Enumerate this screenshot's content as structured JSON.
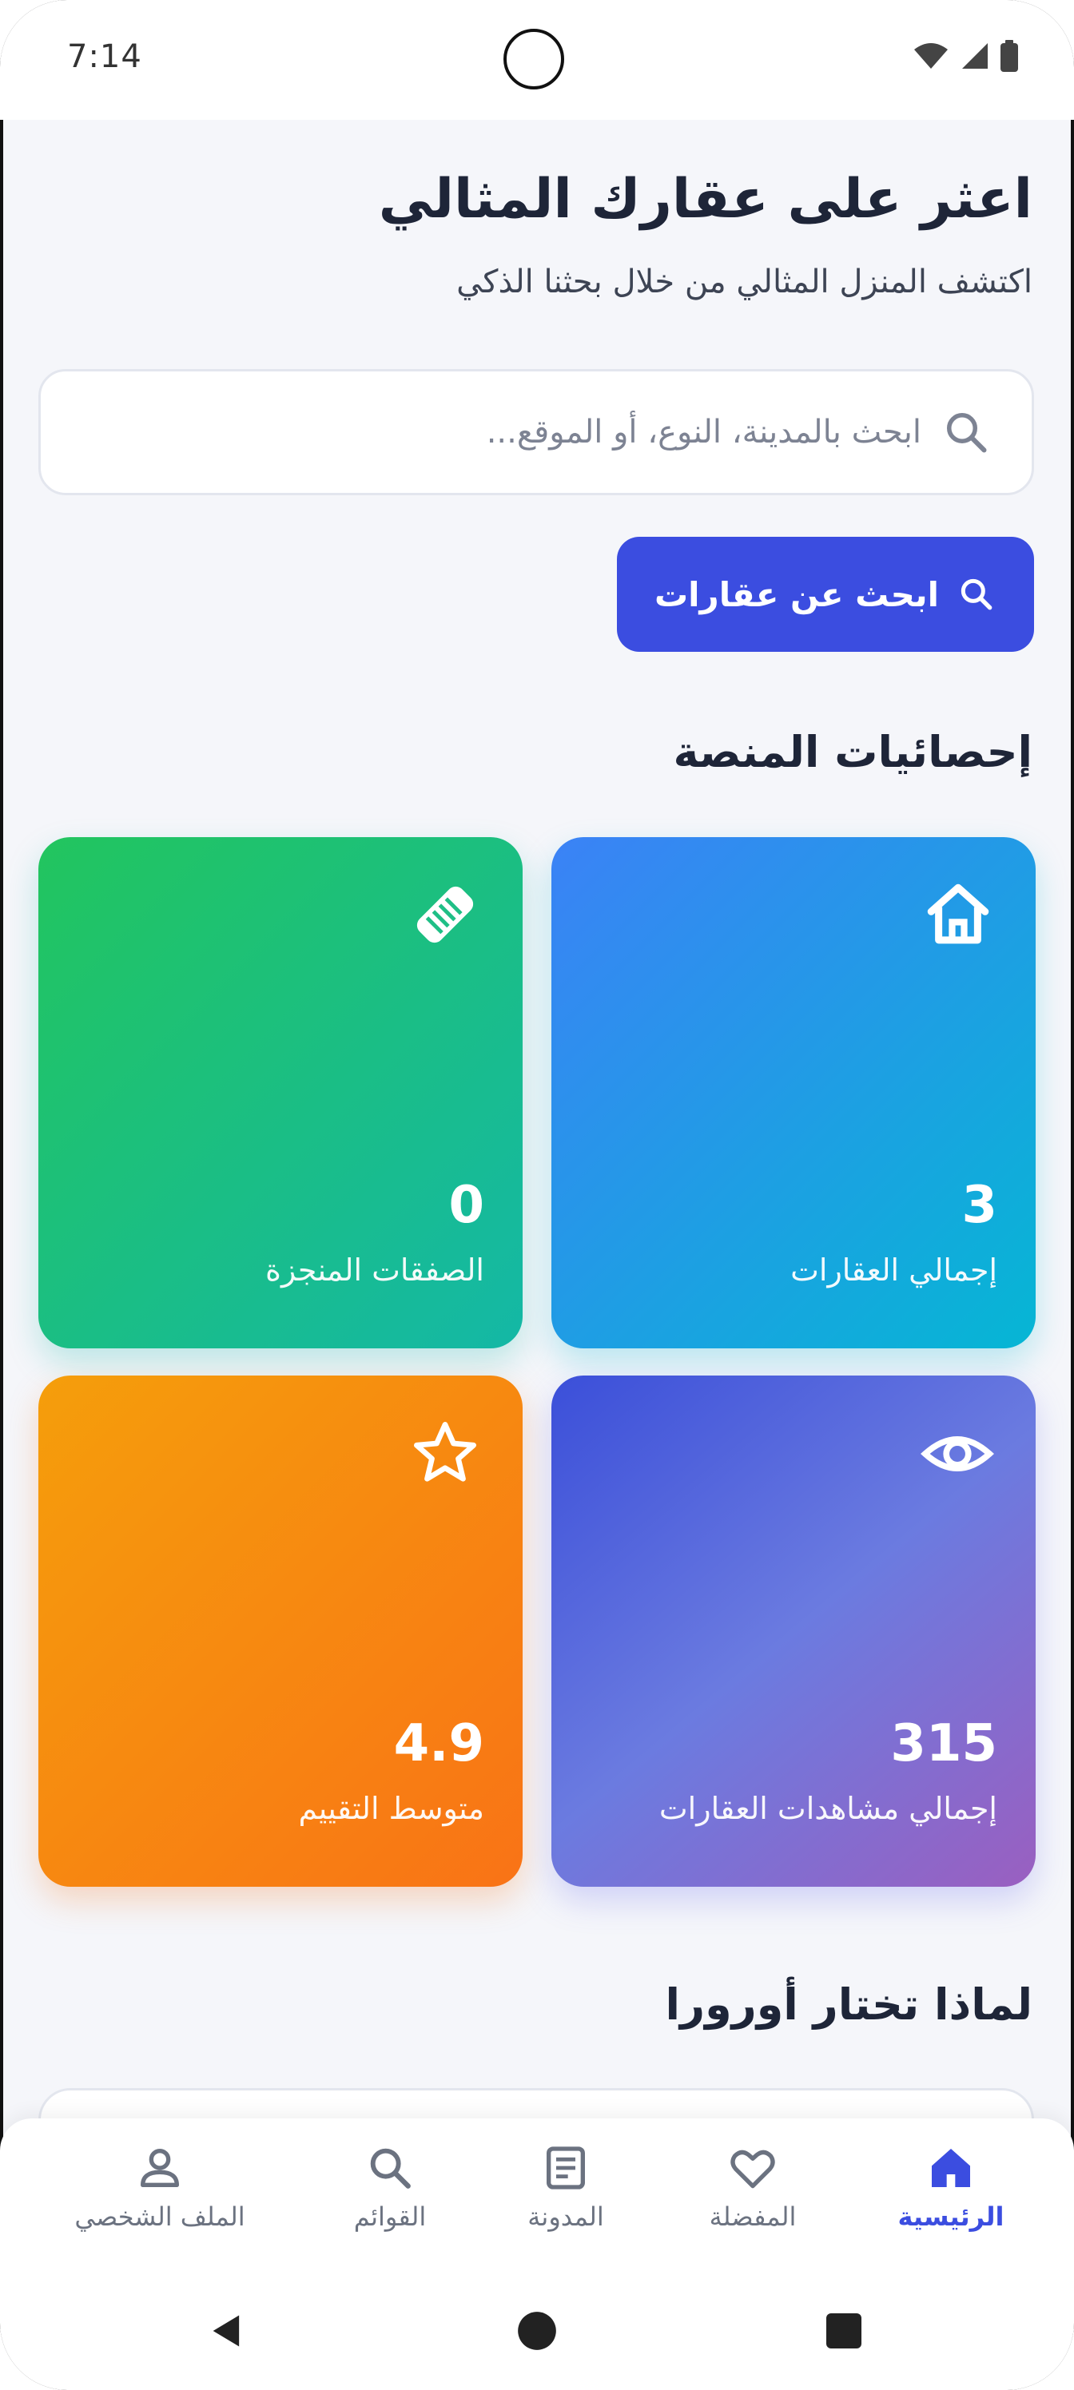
{
  "status_bar": {
    "time": "7:14"
  },
  "hero": {
    "title": "اعثر على عقارك المثالي",
    "subtitle": "اكتشف المنزل المثالي من خلال بحثنا الذكي"
  },
  "search": {
    "placeholder": "ابحث بالمدينة، النوع، أو الموقع...",
    "button_label": "ابحث عن عقارات"
  },
  "stats": {
    "title": "إحصائيات المنصة",
    "cards": [
      {
        "value": "3",
        "label": "إجمالي العقارات",
        "icon": "home-icon"
      },
      {
        "value": "0",
        "label": "الصفقات المنجزة",
        "icon": "handshake-icon"
      },
      {
        "value": "315",
        "label": "إجمالي مشاهدات العقارات",
        "icon": "eye-icon"
      },
      {
        "value": "4.9",
        "label": "متوسط التقييم",
        "icon": "star-icon"
      }
    ]
  },
  "why": {
    "title": "لماذا تختار أورورا"
  },
  "nav": {
    "items": [
      {
        "label": "الرئيسية",
        "icon": "home-icon",
        "active": true
      },
      {
        "label": "المفضلة",
        "icon": "heart-icon",
        "active": false
      },
      {
        "label": "المدونة",
        "icon": "article-icon",
        "active": false
      },
      {
        "label": "القوائم",
        "icon": "search-icon",
        "active": false
      },
      {
        "label": "الملف الشخصي",
        "icon": "person-icon",
        "active": false
      }
    ]
  },
  "colors": {
    "primary": "#3b4de0",
    "heading": "#1e2538"
  }
}
